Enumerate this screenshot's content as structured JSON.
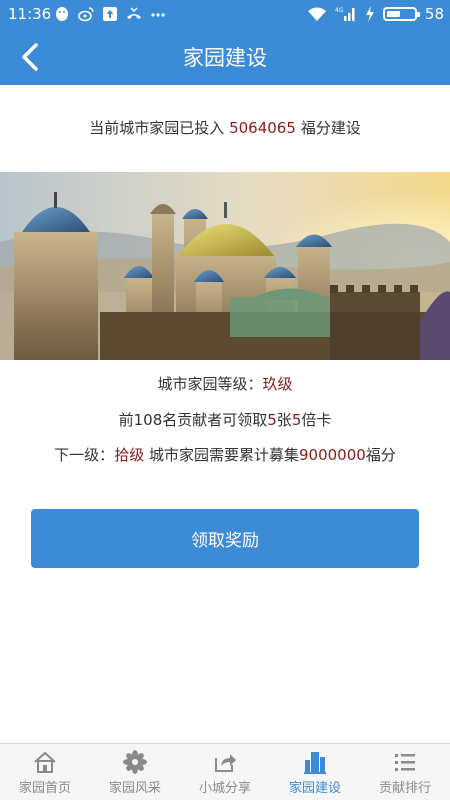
{
  "status_bar": {
    "time": "11:36",
    "battery": "58",
    "battery_level": 0.58,
    "icons": [
      "qq-icon",
      "weibo-icon",
      "upload-icon",
      "missed-call-icon",
      "more-dots-icon",
      "wifi-icon",
      "signal-4g-icon",
      "charging-icon",
      "battery-icon"
    ]
  },
  "header": {
    "title": "家园建设"
  },
  "invest": {
    "prefix": "当前城市家园已投入",
    "amount": "5064065",
    "suffix": "福分建设"
  },
  "info": {
    "level_label": "城市家园等级：",
    "level_value": "玖级",
    "line2_a": "前108名贡献者可领取",
    "line2_b": "5",
    "line2_c": "张",
    "line2_d": "5",
    "line2_e": "倍卡",
    "next_label": "下一级：",
    "next_level": "拾级",
    "next_mid": " 城市家园需要累计募集",
    "next_amount": "9000000",
    "next_unit": "福分"
  },
  "reward_button": "领取奖励",
  "nav": [
    {
      "label": "家园首页",
      "icon": "home-icon",
      "active": false
    },
    {
      "label": "家园风采",
      "icon": "flower-icon",
      "active": false
    },
    {
      "label": "小城分享",
      "icon": "share-icon",
      "active": false
    },
    {
      "label": "家园建设",
      "icon": "building-icon",
      "active": true
    },
    {
      "label": "贡献排行",
      "icon": "ranking-list-icon",
      "active": false
    }
  ],
  "colors": {
    "primary": "#3c8bd6",
    "highlight": "#8b1a1a",
    "nav_inactive": "#8a8a8a"
  }
}
